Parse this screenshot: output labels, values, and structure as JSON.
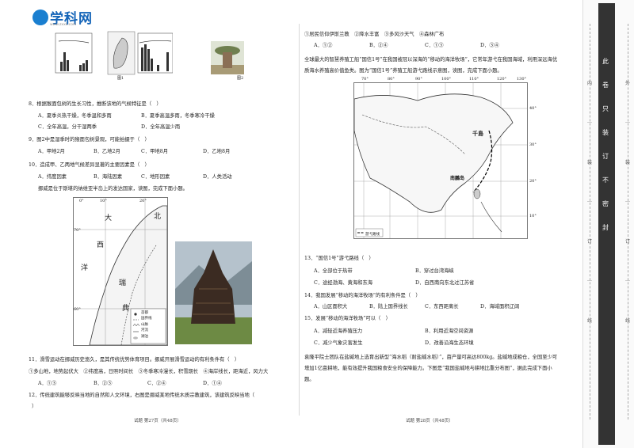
{
  "logo": {
    "name": "学科网",
    "url": "www.zxxk.com"
  },
  "left": {
    "fig1": {
      "map_label": "图1",
      "photo_label": "图2"
    },
    "q8": {
      "stem": "8．根据猴面包树的生长习性，推断该地的气候特征是（　）",
      "A": "A．夏季炎热干燥，冬季温和多雨",
      "B": "B．夏季高温多雨，冬季寒冷干燥",
      "C": "C．全年高温，分干湿两季",
      "D": "D．全年高温少雨"
    },
    "q9": {
      "stem": "9．图2中是湿季时的猴面包树景观，可能拍摄于（　）",
      "A": "A．甲地2月",
      "B": "B．乙地2月",
      "C": "C．甲地8月",
      "D": "D．乙地8月"
    },
    "q10": {
      "stem": "10．造成甲、乙两地气候差异显著的主要因素是（　）",
      "A": "A．纬度因素",
      "B": "B．海陆因素",
      "C": "C．地形因素",
      "D": "D．人类活动"
    },
    "intro2": "挪威是位于斯堪的纳维亚半岛上的发达国家，读图，完成下面小题。",
    "map2": {
      "lon": "0°",
      "lon2": "10°",
      "lon3": "20°",
      "lat": "70°",
      "lat2": "60°",
      "w1": "大",
      "w2": "西",
      "w3": "洋",
      "e1": "瑞",
      "e2": "典",
      "ocean": "北",
      "legend1": "首都",
      "legend2": "国界线",
      "legend3": "山脉",
      "legend4": "河流",
      "legend5": "湖泊"
    },
    "q11": {
      "stem": "11．滑雪运动在挪威历史悠久，是其传统优势体育项目。挪威开展滑雪运动的有利条件有（　）",
      "opts": "①多山地，地势起伏大　②纬度高，日照时间长　③冬季寒冷漫长，积雪期长　④海岸线长，距海近，风力大",
      "A": "A．①③",
      "B": "B．②③",
      "C": "C．②④",
      "D": "D．①④"
    },
    "q12": {
      "stem": "12．传统建筑能够反映当地的自然和人文环境，右图是挪威某地传统木质宗教建筑，该建筑反映当地（　",
      "cont": "）"
    },
    "footer": "试题  第27页（共48页）"
  },
  "right": {
    "top_opts": "①居民信仰伊斯兰教　②降水丰富　③多风沙天气　④森林广布",
    "top_abcd": {
      "A": "A．①②",
      "B": "B．②④",
      "C": "C．①③",
      "D": "D．③④"
    },
    "intro": "全球最大的智慧养殖工船“国信1号”在我国被冠以深海的“移动的海洋牧场”，它常年游弋在我国海域，利用深远海优质海水养殖高价值鱼类。图为“国信1号”养殖工船游弋路线示意图，读图，完成下面小题。",
    "map": {
      "lon1": "70°",
      "lon2": "80°",
      "lon3": "90°",
      "lon4": "100°",
      "lon5": "110°",
      "lon6": "120°",
      "lon7": "130°",
      "lat1": "40°",
      "lat2": "30°",
      "lat3": "20°",
      "lat4": "10°",
      "label1": "千島",
      "label2": "南鵬岛",
      "legend": "游弋路线"
    },
    "q13": {
      "stem": "13．“国信1号”游弋路线（　）",
      "A": "A．全部位于热带",
      "B": "B．穿过台湾海峡",
      "C": "C．途经渤海、黄海和东海",
      "D": "D．自西南向东北过江苏省"
    },
    "q14": {
      "stem": "14．我国发展“移动的海洋牧场”的有利条件是（　）",
      "A": "A．山区面积大",
      "B": "B．陆上国界线长",
      "C": "C．东西距离长",
      "D": "D．海域面积辽阔"
    },
    "q15": {
      "stem": "15．发展“移动的海洋牧场”可以（　）",
      "A": "A．减轻近海养殖压力",
      "B": "B．利用近海空间资源",
      "C": "C．减少气象灾害发生",
      "D": "D．改善沿海生态环境"
    },
    "intro2": "袁隆平院士团队在盐碱地上选育出新型“海水稻（耐盐碱水稻）”，亩产量可高达800kg。盐碱地成粮仓，全国至少可增加1亿亩耕地，能有效提升我国粮食安全的保障能力。下图是“我国盐碱地与耕地比重分布图”，据此完成下面小题。",
    "footer": "试题  第28页（共48页）"
  },
  "sidebar": {
    "chars": [
      "此",
      "卷",
      "只",
      "装",
      "订",
      "不",
      "密",
      "封"
    ],
    "left_marks": [
      "内",
      "…",
      "装",
      "…",
      "订",
      "…",
      "线"
    ],
    "right_marks": [
      "外",
      "…",
      "装",
      "…",
      "订",
      "…",
      "线"
    ]
  }
}
